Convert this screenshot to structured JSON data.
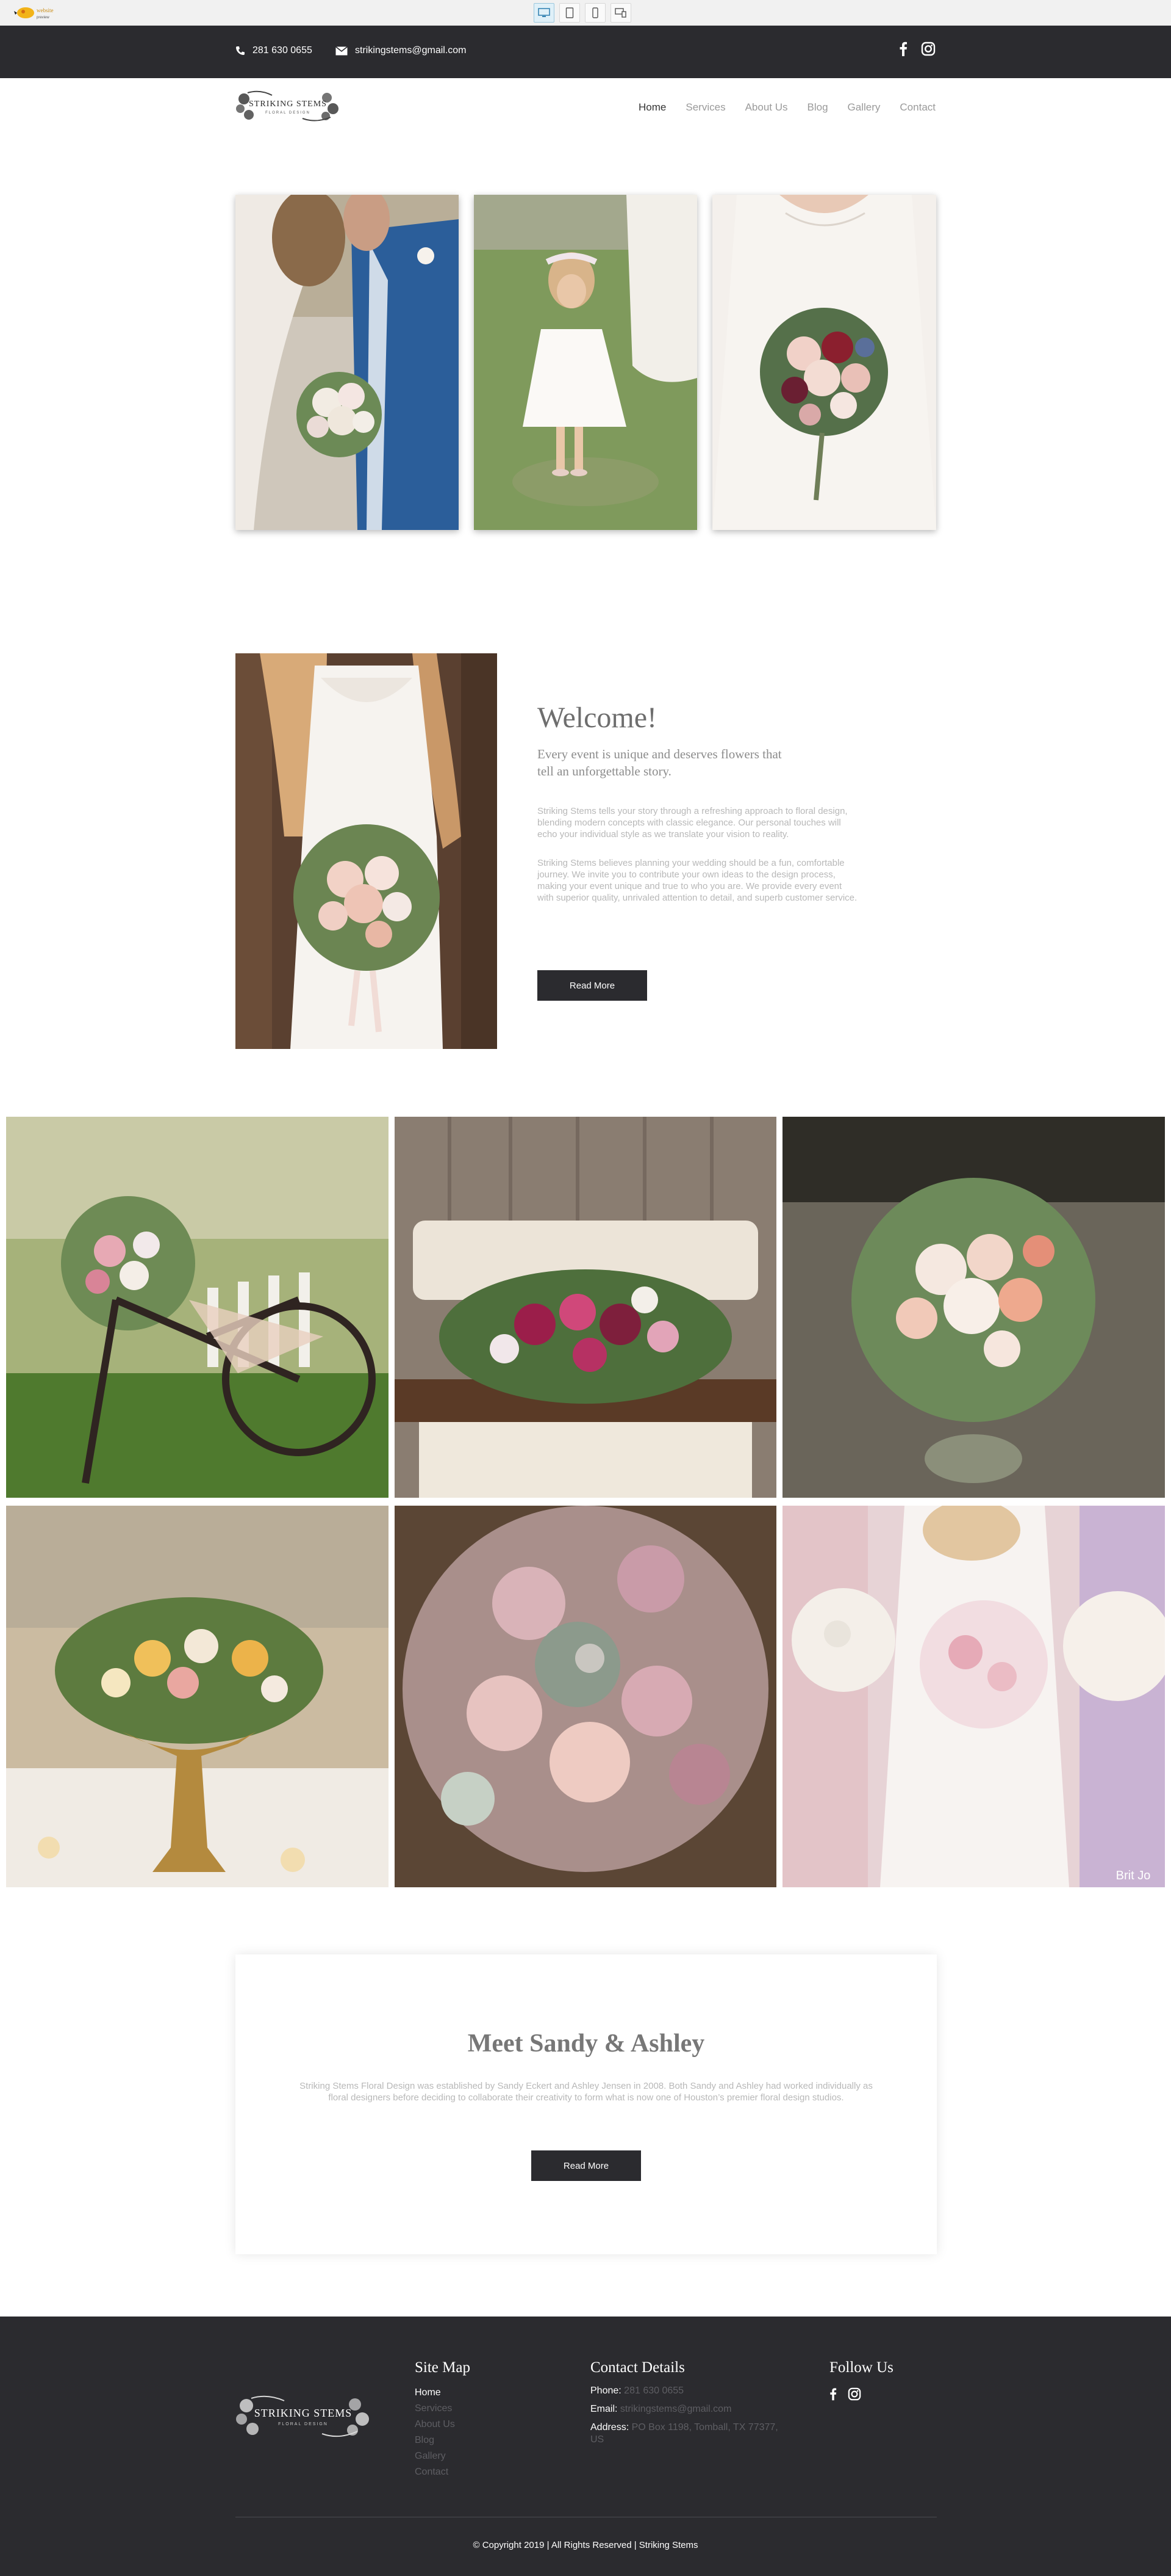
{
  "preview_bar": {
    "logo_alt": "preview logo",
    "devices": [
      "desktop",
      "tablet",
      "phone",
      "responsive"
    ]
  },
  "topbar": {
    "phone": "281 630 0655",
    "email": "strikingstems@gmail.com",
    "social_icons": [
      "facebook-icon",
      "instagram-icon"
    ]
  },
  "header": {
    "logo_text": "STRIKING STEMS",
    "logo_subtext": "FLORAL DESIGN",
    "nav": [
      "Home",
      "Services",
      "About Us",
      "Blog",
      "Gallery",
      "Contact"
    ],
    "active_nav": "Home"
  },
  "welcome": {
    "title": "Welcome!",
    "subtitle": "Every event is unique and deserves flowers that tell an unforgettable story.",
    "para1": "Striking Stems tells your story through a refreshing approach to floral design, blending modern concepts with classic elegance. Our personal touches will echo your individual style as we translate your vision to reality.",
    "para2": "Striking Stems believes planning your wedding should be a fun, comfortable journey. We invite you to contribute your own ideas to the design process, making your event unique and true to who you are. We provide every event with superior quality, unrivaled attention to detail, and superb customer service.",
    "button": "Read More"
  },
  "gallery": {
    "watermark": "Brit Jo"
  },
  "meet": {
    "title": "Meet Sandy & Ashley",
    "text": "Striking Stems Floral Design was established by Sandy Eckert and Ashley Jensen in 2008. Both Sandy and Ashley had worked individually as floral designers before deciding to collaborate their creativity to form what is now one of Houston’s premier floral design studios.",
    "button": "Read More"
  },
  "footer": {
    "logo_text": "STRIKING STEMS",
    "logo_subtext": "FLORAL DESIGN",
    "sitemap_title": "Site Map",
    "sitemap": [
      "Home",
      "Services",
      "About Us",
      "Blog",
      "Gallery",
      "Contact"
    ],
    "contact_title": "Contact Details",
    "phone_label": "Phone:",
    "phone": "281 630 0655",
    "email_label": "Email:",
    "email": "strikingstems@gmail.com",
    "address_label": "Address:",
    "address": "PO Box 1198, Tomball, TX 77377, US",
    "follow_title": "Follow Us",
    "copyright": "© Copyright 2019  |  All Rights Reserved  |  Striking Stems"
  },
  "colors": {
    "dark": "#2b2b2f",
    "muted_text": "#b8b8b8",
    "heading": "#6e6e6e"
  }
}
